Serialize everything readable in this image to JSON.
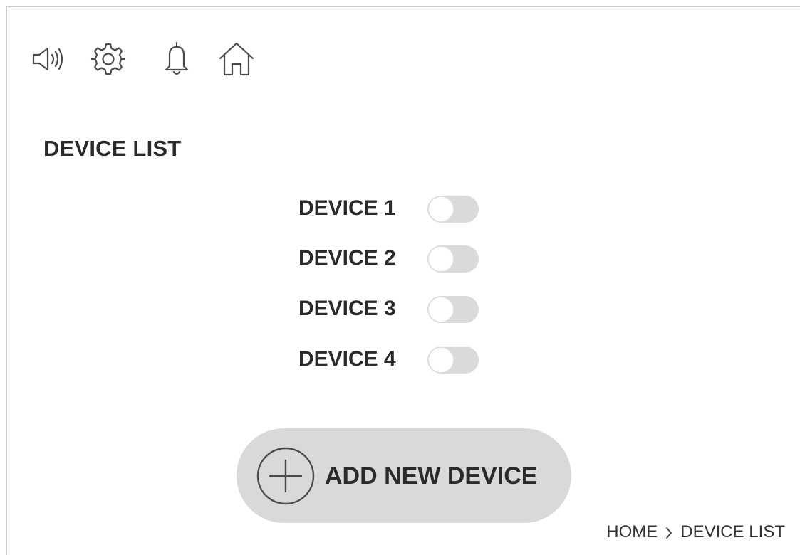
{
  "toolbar": {
    "icons": [
      "speaker-icon",
      "gear-icon",
      "bell-icon",
      "home-icon"
    ]
  },
  "page": {
    "title": "DEVICE LIST"
  },
  "devices": [
    {
      "label": "DEVICE 1",
      "enabled": false
    },
    {
      "label": "DEVICE 2",
      "enabled": false
    },
    {
      "label": "DEVICE 3",
      "enabled": false
    },
    {
      "label": "DEVICE 4",
      "enabled": false
    }
  ],
  "add_button": {
    "label": "ADD NEW DEVICE",
    "icon": "plus-circle-icon"
  },
  "breadcrumb": {
    "items": [
      "HOME",
      "DEVICE LIST"
    ],
    "separator_icon": "chevron-right-icon"
  },
  "colors": {
    "toggle_off": "#dadada",
    "button_bg": "#d9d9d9",
    "text": "#2a2a2a",
    "frame_border": "#c9c9c9"
  }
}
